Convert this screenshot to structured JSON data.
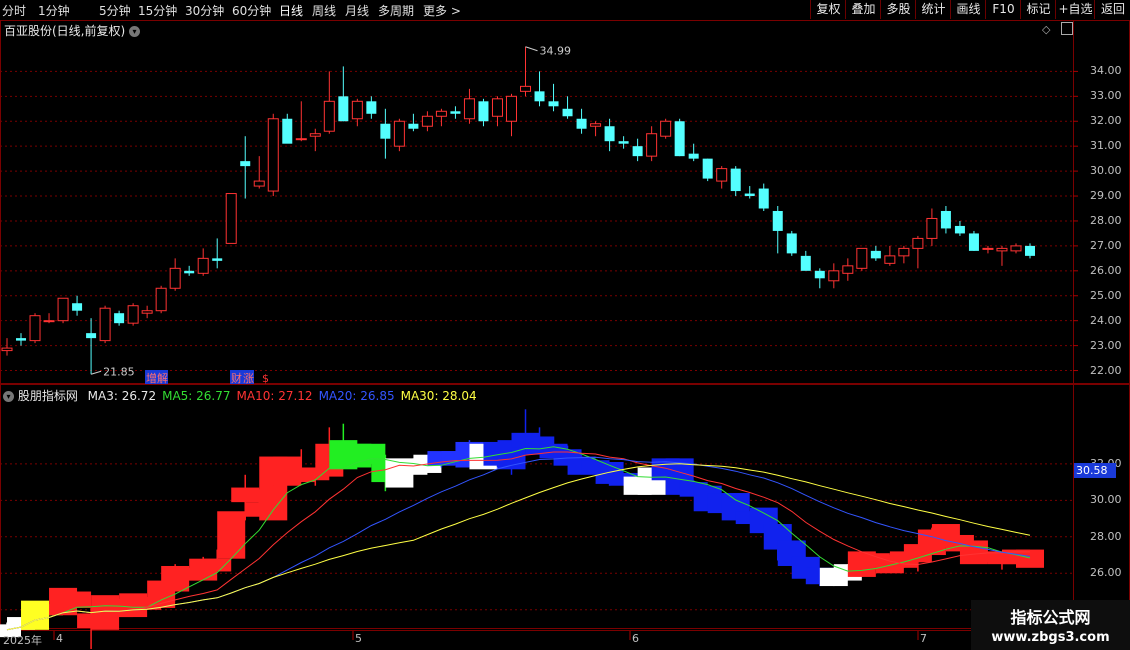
{
  "toolbar": {
    "left": [
      "分时",
      "1分钟",
      "5分钟",
      "15分钟",
      "30分钟",
      "60分钟",
      "日线",
      "周线",
      "月线",
      "多周期",
      "更多 >"
    ],
    "right": [
      "复权",
      "叠加",
      "多股",
      "统计",
      "画线",
      "F10",
      "标记",
      "+自选",
      "返回"
    ],
    "active": "日线"
  },
  "main_panel": {
    "title": "百亚股份(日线,前复权)",
    "high_label": "34.99",
    "low_label": "21.85",
    "event_labels": [
      "增",
      "解",
      "财",
      "涨",
      "$"
    ]
  },
  "indicator_panel": {
    "title": "股朋指标网",
    "legend": [
      {
        "label": "MA3: 26.72",
        "color": "#e8e8e8"
      },
      {
        "label": "MA5: 26.77",
        "color": "#33dd33"
      },
      {
        "label": "MA10: 27.12",
        "color": "#ff3333"
      },
      {
        "label": "MA20: 26.85",
        "color": "#3355ff"
      },
      {
        "label": "MA30: 28.04",
        "color": "#ffff44"
      }
    ],
    "price_tag": "30.58"
  },
  "price_axis": [
    "34.00",
    "33.00",
    "32.00",
    "31.00",
    "30.00",
    "29.00",
    "28.00",
    "27.00",
    "26.00",
    "25.00",
    "24.00",
    "23.00",
    "22.00"
  ],
  "indicator_axis": [
    "32.00",
    "30.00",
    "28.00",
    "26.00",
    "24.00"
  ],
  "date_axis": [
    "2025年",
    "4",
    "5",
    "6",
    "7"
  ],
  "watermark": {
    "line1": "指标公式网",
    "line2": "www.zbgs3.com"
  },
  "colors": {
    "up": "#ff3333",
    "down": "#54ffff",
    "grid": "#7a0000"
  },
  "chart_data": {
    "type": "candlestick",
    "note_units": "price",
    "candles": [
      [
        22.8,
        23.3,
        22.6,
        22.9
      ],
      [
        23.3,
        23.5,
        23.0,
        23.2
      ],
      [
        23.2,
        24.3,
        23.1,
        24.2
      ],
      [
        24.0,
        24.3,
        23.9,
        24.0
      ],
      [
        24.0,
        24.9,
        23.9,
        24.9
      ],
      [
        24.7,
        25.0,
        24.2,
        24.4
      ],
      [
        23.5,
        24.1,
        21.85,
        23.3
      ],
      [
        23.2,
        24.6,
        23.1,
        24.5
      ],
      [
        24.3,
        24.4,
        23.8,
        23.9
      ],
      [
        23.9,
        24.7,
        23.8,
        24.6
      ],
      [
        24.3,
        24.6,
        24.1,
        24.4
      ],
      [
        24.4,
        25.4,
        24.3,
        25.3
      ],
      [
        25.3,
        26.5,
        25.2,
        26.1
      ],
      [
        26.0,
        26.2,
        25.8,
        25.9
      ],
      [
        25.9,
        26.9,
        25.8,
        26.5
      ],
      [
        26.5,
        27.3,
        26.1,
        26.4
      ],
      [
        27.1,
        29.1,
        27.1,
        29.1
      ],
      [
        30.4,
        31.4,
        28.9,
        30.2
      ],
      [
        29.4,
        30.6,
        29.3,
        29.6
      ],
      [
        29.2,
        32.3,
        29.0,
        32.1
      ],
      [
        32.1,
        32.3,
        31.4,
        31.1
      ],
      [
        31.3,
        32.8,
        31.2,
        31.3
      ],
      [
        31.4,
        31.7,
        30.8,
        31.5
      ],
      [
        31.6,
        34.0,
        31.5,
        32.8
      ],
      [
        33.0,
        34.2,
        32.0,
        32.0
      ],
      [
        32.1,
        32.9,
        31.8,
        32.8
      ],
      [
        32.8,
        33.0,
        32.1,
        32.3
      ],
      [
        31.9,
        32.5,
        30.5,
        31.3
      ],
      [
        31.0,
        32.1,
        30.8,
        32.0
      ],
      [
        31.9,
        32.3,
        31.6,
        31.7
      ],
      [
        31.8,
        32.4,
        31.6,
        32.2
      ],
      [
        32.2,
        32.5,
        31.8,
        32.4
      ],
      [
        32.4,
        32.6,
        32.1,
        32.3
      ],
      [
        32.1,
        33.3,
        31.9,
        32.9
      ],
      [
        32.8,
        32.9,
        31.8,
        32.0
      ],
      [
        32.2,
        33.0,
        31.8,
        32.9
      ],
      [
        32.0,
        33.1,
        31.4,
        33.0
      ],
      [
        33.2,
        34.99,
        33.0,
        33.4
      ],
      [
        33.2,
        34.0,
        32.6,
        32.8
      ],
      [
        32.8,
        33.5,
        32.4,
        32.6
      ],
      [
        32.5,
        33.0,
        32.1,
        32.2
      ],
      [
        32.1,
        32.5,
        31.5,
        31.7
      ],
      [
        31.8,
        32.0,
        31.4,
        31.9
      ],
      [
        31.8,
        32.1,
        30.8,
        31.2
      ],
      [
        31.2,
        31.4,
        30.9,
        31.1
      ],
      [
        31.0,
        31.3,
        30.4,
        30.6
      ],
      [
        30.6,
        31.8,
        30.4,
        31.5
      ],
      [
        31.4,
        32.1,
        31.3,
        32.0
      ],
      [
        32.0,
        32.1,
        30.6,
        30.6
      ],
      [
        30.7,
        31.1,
        30.4,
        30.5
      ],
      [
        30.5,
        30.5,
        29.6,
        29.7
      ],
      [
        29.6,
        30.2,
        29.3,
        30.1
      ],
      [
        30.1,
        30.2,
        29.0,
        29.2
      ],
      [
        29.1,
        29.4,
        28.9,
        29.0
      ],
      [
        29.3,
        29.5,
        28.4,
        28.5
      ],
      [
        28.4,
        28.6,
        26.7,
        27.6
      ],
      [
        27.5,
        27.6,
        26.6,
        26.7
      ],
      [
        26.6,
        26.8,
        26.1,
        26.0
      ],
      [
        26.0,
        26.1,
        25.3,
        25.7
      ],
      [
        25.6,
        26.3,
        25.3,
        26.0
      ],
      [
        25.9,
        26.5,
        25.6,
        26.2
      ],
      [
        26.1,
        26.9,
        26.0,
        26.9
      ],
      [
        26.8,
        27.0,
        26.4,
        26.5
      ],
      [
        26.3,
        27.0,
        26.2,
        26.6
      ],
      [
        26.6,
        27.0,
        26.3,
        26.9
      ],
      [
        26.9,
        27.4,
        26.1,
        27.3
      ],
      [
        27.3,
        28.5,
        27.0,
        28.1
      ],
      [
        28.4,
        28.6,
        27.5,
        27.7
      ],
      [
        27.8,
        28.0,
        27.4,
        27.5
      ],
      [
        27.5,
        27.6,
        26.8,
        26.8
      ],
      [
        26.9,
        27.0,
        26.7,
        26.9
      ],
      [
        26.8,
        27.0,
        26.2,
        26.9
      ],
      [
        26.8,
        27.1,
        26.7,
        27.0
      ],
      [
        27.0,
        27.1,
        26.5,
        26.6
      ]
    ],
    "xlim_dates": [
      "2025-03",
      "2025-07"
    ],
    "ylim": [
      21.5,
      35.5
    ],
    "grid": true
  }
}
